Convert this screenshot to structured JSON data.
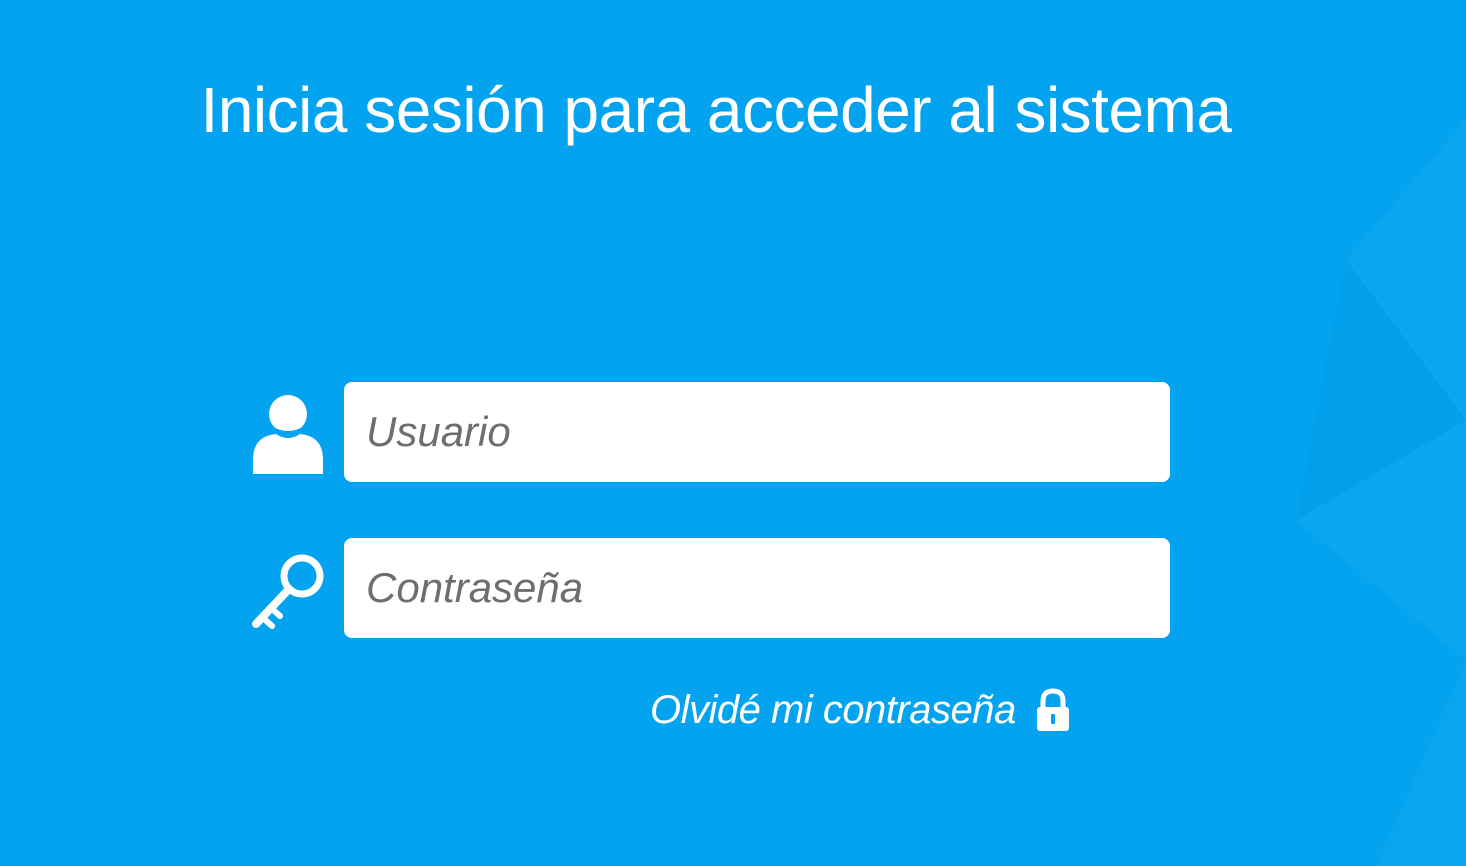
{
  "login": {
    "title": "Inicia sesión para acceder al sistema",
    "username": {
      "placeholder": "Usuario",
      "value": "",
      "icon": "user-icon"
    },
    "password": {
      "placeholder": "Contraseña",
      "value": "",
      "icon": "key-icon"
    },
    "forgot_password": {
      "label": "Olvidé mi contraseña",
      "icon": "lock-icon"
    }
  },
  "theme": {
    "background": "#03a3ef",
    "input_background": "#ffffff",
    "text_color": "#ffffff",
    "placeholder_color": "#6e6e6e"
  }
}
